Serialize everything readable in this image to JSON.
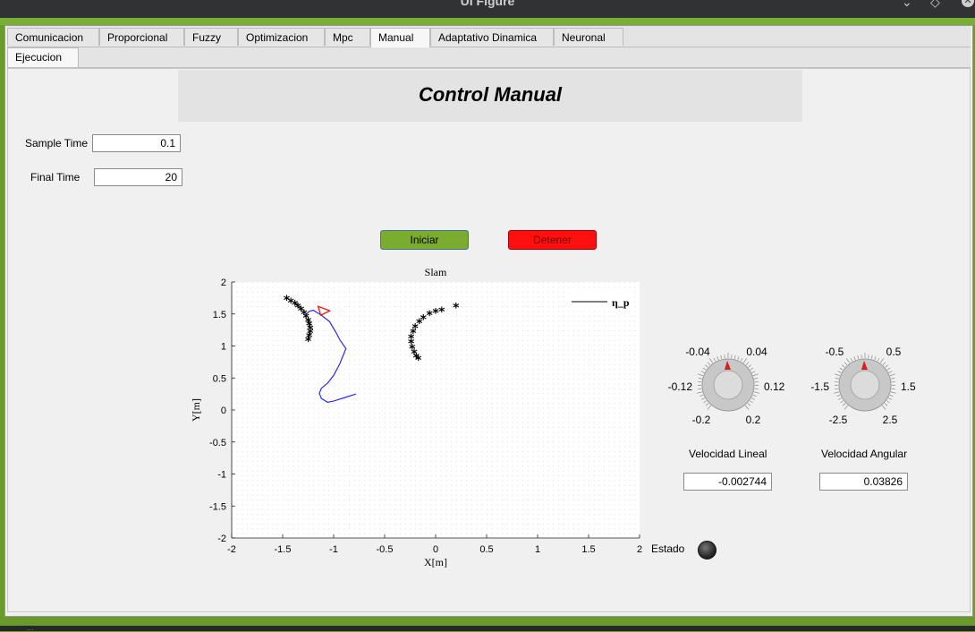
{
  "window": {
    "title": "UI Figure"
  },
  "colors": {
    "accent_green": "#7aad34",
    "start_button": "#7aac30",
    "stop_button": "#ff1010",
    "trajectory": "#1a1aff",
    "robot": "#ff0000",
    "landmarks": "#000000"
  },
  "tabs_row1": [
    {
      "label": "Comunicacion",
      "active": false
    },
    {
      "label": "Proporcional",
      "active": false
    },
    {
      "label": "Fuzzy",
      "active": false
    },
    {
      "label": "Optimizacion",
      "active": false
    },
    {
      "label": "Mpc",
      "active": false
    },
    {
      "label": "Manual",
      "active": true
    },
    {
      "label": "Adaptativo Dinamica",
      "active": false
    },
    {
      "label": "Neuronal",
      "active": false
    }
  ],
  "tabs_row2": [
    {
      "label": "Ejecucion",
      "active": true
    }
  ],
  "header": {
    "title": "Control Manual"
  },
  "params": {
    "sample_time_label": "Sample Time",
    "sample_time_value": "0.1",
    "final_time_label": "Final Time",
    "final_time_value": "20"
  },
  "buttons": {
    "start_label": "Iniciar",
    "stop_label": "Detener"
  },
  "chart_data": {
    "type": "line",
    "title": "Slam",
    "xlabel": "X[m]",
    "ylabel": "Y[m]",
    "xlim": [
      -2,
      2
    ],
    "ylim": [
      -2,
      2
    ],
    "xticks": [
      "-2",
      "-1.5",
      "-1",
      "-0.5",
      "0",
      "0.5",
      "1",
      "1.5",
      "2"
    ],
    "yticks": [
      "-2",
      "-1.5",
      "-1",
      "-0.5",
      "0",
      "0.5",
      "1",
      "1.5",
      "2"
    ],
    "grid": true,
    "legend": {
      "entries": [
        "η_p"
      ],
      "placement": "top-right"
    },
    "series": [
      {
        "name": "η_p",
        "x": [
          -0.78,
          -0.88,
          -1.0,
          -1.06,
          -1.12,
          -1.14,
          -1.12,
          -1.06,
          -1.0,
          -0.94,
          -0.88,
          -0.94,
          -0.98,
          -1.04,
          -1.12,
          -1.2,
          -1.24,
          -1.28
        ],
        "y": [
          0.25,
          0.2,
          0.14,
          0.12,
          0.18,
          0.26,
          0.34,
          0.42,
          0.54,
          0.72,
          0.96,
          1.1,
          1.22,
          1.38,
          1.48,
          1.56,
          1.54,
          1.48
        ]
      }
    ],
    "landmarks_left": {
      "x": [
        -1.46,
        -1.42,
        -1.38,
        -1.35,
        -1.32,
        -1.29,
        -1.27,
        -1.25,
        -1.24,
        -1.23,
        -1.23,
        -1.24,
        -1.25
      ],
      "y": [
        1.72,
        1.68,
        1.64,
        1.6,
        1.55,
        1.5,
        1.44,
        1.38,
        1.32,
        1.26,
        1.2,
        1.14,
        1.08
      ]
    },
    "landmarks_right": {
      "x": [
        0.2,
        0.06,
        0.0,
        -0.06,
        -0.12,
        -0.16,
        -0.2,
        -0.22,
        -0.24,
        -0.24,
        -0.23,
        -0.21,
        -0.19,
        -0.17
      ],
      "y": [
        1.6,
        1.54,
        1.52,
        1.48,
        1.42,
        1.36,
        1.28,
        1.2,
        1.12,
        1.04,
        0.96,
        0.88,
        0.82,
        0.78
      ]
    },
    "robot": {
      "x": -1.1,
      "y": 1.55
    }
  },
  "knobs": [
    {
      "label": "Velocidad Lineal",
      "value": "-0.002744",
      "ticks": [
        "-0.04",
        "0.04",
        "-0.12",
        "0.12",
        "-0.2",
        "0.2"
      ]
    },
    {
      "label": "Velocidad Angular",
      "value": "0.03826",
      "ticks": [
        "-0.5",
        "0.5",
        "-1.5",
        "1.5",
        "-2.5",
        "2.5"
      ]
    }
  ],
  "estado": {
    "label": "Estado"
  },
  "statusbar": {
    "text": "..."
  }
}
